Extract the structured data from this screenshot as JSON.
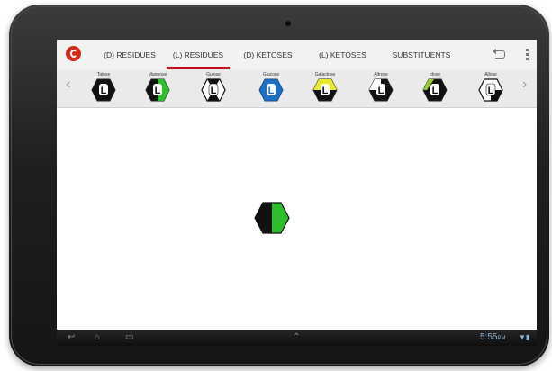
{
  "app": {
    "logo_icon": "glycan-builder-logo-icon",
    "accent_color": "#c3101a"
  },
  "tabs": [
    {
      "label": "(D) RESIDUES",
      "selected": false
    },
    {
      "label": "(L) RESIDUES",
      "selected": true
    },
    {
      "label": "(D) KETOSES",
      "selected": false
    },
    {
      "label": "(L) KETOSES",
      "selected": false
    },
    {
      "label": "SUBSTITUENTS",
      "selected": false
    }
  ],
  "actions": {
    "undo_icon": "undo-icon",
    "overflow_icon": "overflow-menu-icon"
  },
  "strip": {
    "prev_glyph": "‹",
    "next_glyph": "›"
  },
  "residues": [
    {
      "name": "Talose",
      "letter": "L",
      "fill": "#111111",
      "split": "none"
    },
    {
      "name": "Mannose",
      "letter": "L",
      "fill": "#111111",
      "split": "green"
    },
    {
      "name": "Gulose",
      "letter": "L",
      "fill": "#ffffff",
      "split": "hourglass"
    },
    {
      "name": "Glucose",
      "letter": "L",
      "fill": "#1f6fc2",
      "split": "none"
    },
    {
      "name": "Galactose",
      "letter": "L",
      "fill": "#e8ea2a",
      "split": "yellow-top"
    },
    {
      "name": "Altrose",
      "letter": "L",
      "fill": "#111111",
      "split": "white-left"
    },
    {
      "name": "Idose",
      "letter": "L",
      "fill": "#111111",
      "split": "green-edge"
    },
    {
      "name": "Allose",
      "letter": "L",
      "fill": "#ffffff",
      "split": "black-right"
    }
  ],
  "canvas": {
    "placed_residue": "mannose-hexagon",
    "left_color": "#111111",
    "right_color": "#2dbd2d"
  },
  "system": {
    "time": "5:55",
    "ampm": "PM",
    "signal": "▼▮",
    "back_glyph": "↩",
    "home_glyph": "⌂",
    "recent_glyph": "▭",
    "center_glyph": "⌃"
  }
}
